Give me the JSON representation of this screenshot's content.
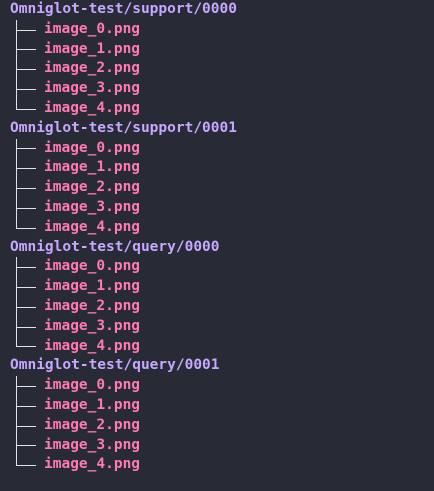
{
  "theme": {
    "background": "#282a36",
    "directory_color": "#c6a8ff",
    "file_color": "#ff7ab2",
    "tree_line_color": "#e3e3e3"
  },
  "tree": [
    {
      "dir": "Omniglot-test/support/0000",
      "files": [
        "image_0.png",
        "image_1.png",
        "image_2.png",
        "image_3.png",
        "image_4.png"
      ]
    },
    {
      "dir": "Omniglot-test/support/0001",
      "files": [
        "image_0.png",
        "image_1.png",
        "image_2.png",
        "image_3.png",
        "image_4.png"
      ]
    },
    {
      "dir": "Omniglot-test/query/0000",
      "files": [
        "image_0.png",
        "image_1.png",
        "image_2.png",
        "image_3.png",
        "image_4.png"
      ]
    },
    {
      "dir": "Omniglot-test/query/0001",
      "files": [
        "image_0.png",
        "image_1.png",
        "image_2.png",
        "image_3.png",
        "image_4.png"
      ]
    }
  ]
}
